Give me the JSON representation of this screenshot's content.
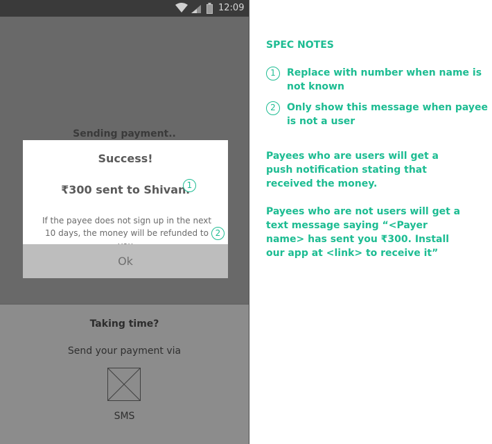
{
  "status_bar": {
    "time": "12:09"
  },
  "background": {
    "sending_text": "Sending payment..",
    "taking_time": "Taking time?",
    "send_via": "Send your payment via",
    "sms_label": "SMS"
  },
  "dialog": {
    "title": "Success!",
    "amount_text": "₹300 sent to Shivani",
    "refund_text": "If the payee does not sign up in the next 10 days, the money will be refunded to you.",
    "ok_label": "Ok",
    "marker_1": "1",
    "marker_2": "2"
  },
  "spec": {
    "title": "SPEC NOTES",
    "notes": [
      {
        "num": "1",
        "text": "Replace with number when name is not known"
      },
      {
        "num": "2",
        "text": "Only show this message when payee is not a user"
      }
    ],
    "paragraph_users": "Payees who are users will get a push notification stating that received the money.",
    "paragraph_non_users": "Payees who are not users will get a text message saying “<Payer name> has sent you ₹300. Install our app at <link> to receive it”"
  },
  "colors": {
    "accent": "#1dbc92",
    "overlay": "#696969",
    "status_bar": "#3a3a3a",
    "ok_button": "#bdbdbd"
  },
  "icons": [
    "wifi-icon",
    "signal-icon",
    "battery-icon",
    "image-placeholder-icon"
  ]
}
